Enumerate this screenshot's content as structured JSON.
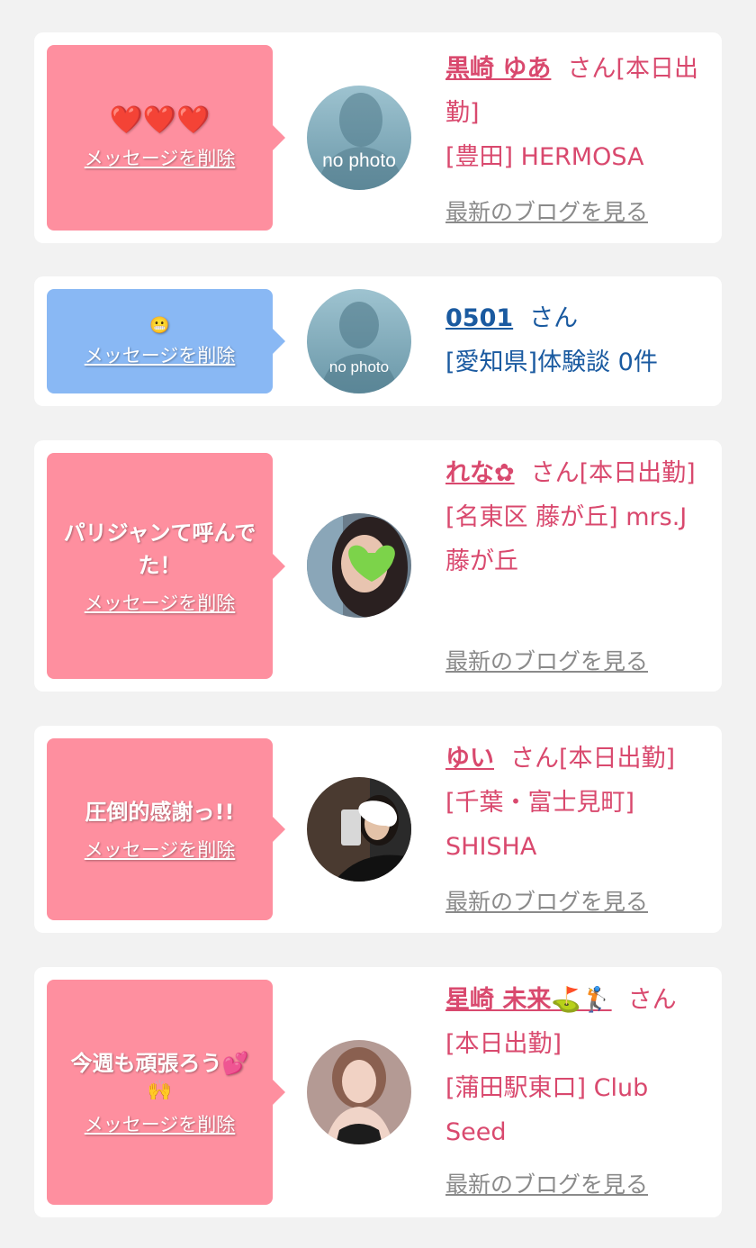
{
  "cards": [
    {
      "message": "❤️❤️❤️",
      "delete_label": "メッセージを削除",
      "avatar_text": "no photo",
      "name": "黒崎 ゆあ",
      "name_suffix": "さん[本日出勤]",
      "shop": "[豊田] HERMOSA",
      "blog_label": "最新のブログを見る"
    },
    {
      "message": "😬",
      "delete_label": "メッセージを削除",
      "avatar_text": "no photo",
      "name": "0501",
      "name_suffix": "さん",
      "shop": "[愛知県]体験談 0件"
    },
    {
      "message": "パリジャンて呼んでた！",
      "delete_label": "メッセージを削除",
      "name": "れな✿",
      "name_suffix": "さん[本日出勤]",
      "shop": "[名東区 藤が丘] mrs.J 藤が丘",
      "blog_label": "最新のブログを見る"
    },
    {
      "message": "圧倒的感謝っ!!",
      "delete_label": "メッセージを削除",
      "name": "ゆい",
      "name_suffix": "さん[本日出勤]",
      "shop": "[千葉・富士見町] SHISHA",
      "blog_label": "最新のブログを見る"
    },
    {
      "message": "今週も頑張ろう💕",
      "message_extra": "🙌",
      "delete_label": "メッセージを削除",
      "name": "星崎 未来⛳🏌️",
      "name_suffix": "さん[本日出勤]",
      "shop": "[蒲田駅東口] Club Seed",
      "blog_label": "最新のブログを見る"
    }
  ],
  "colors": {
    "pink_bubble": "#fe8f9f",
    "blue_bubble": "#89b8f4",
    "name_pink": "#d9496e",
    "name_blue": "#1a5aa0",
    "blog_gray": "#8a8a8a"
  }
}
